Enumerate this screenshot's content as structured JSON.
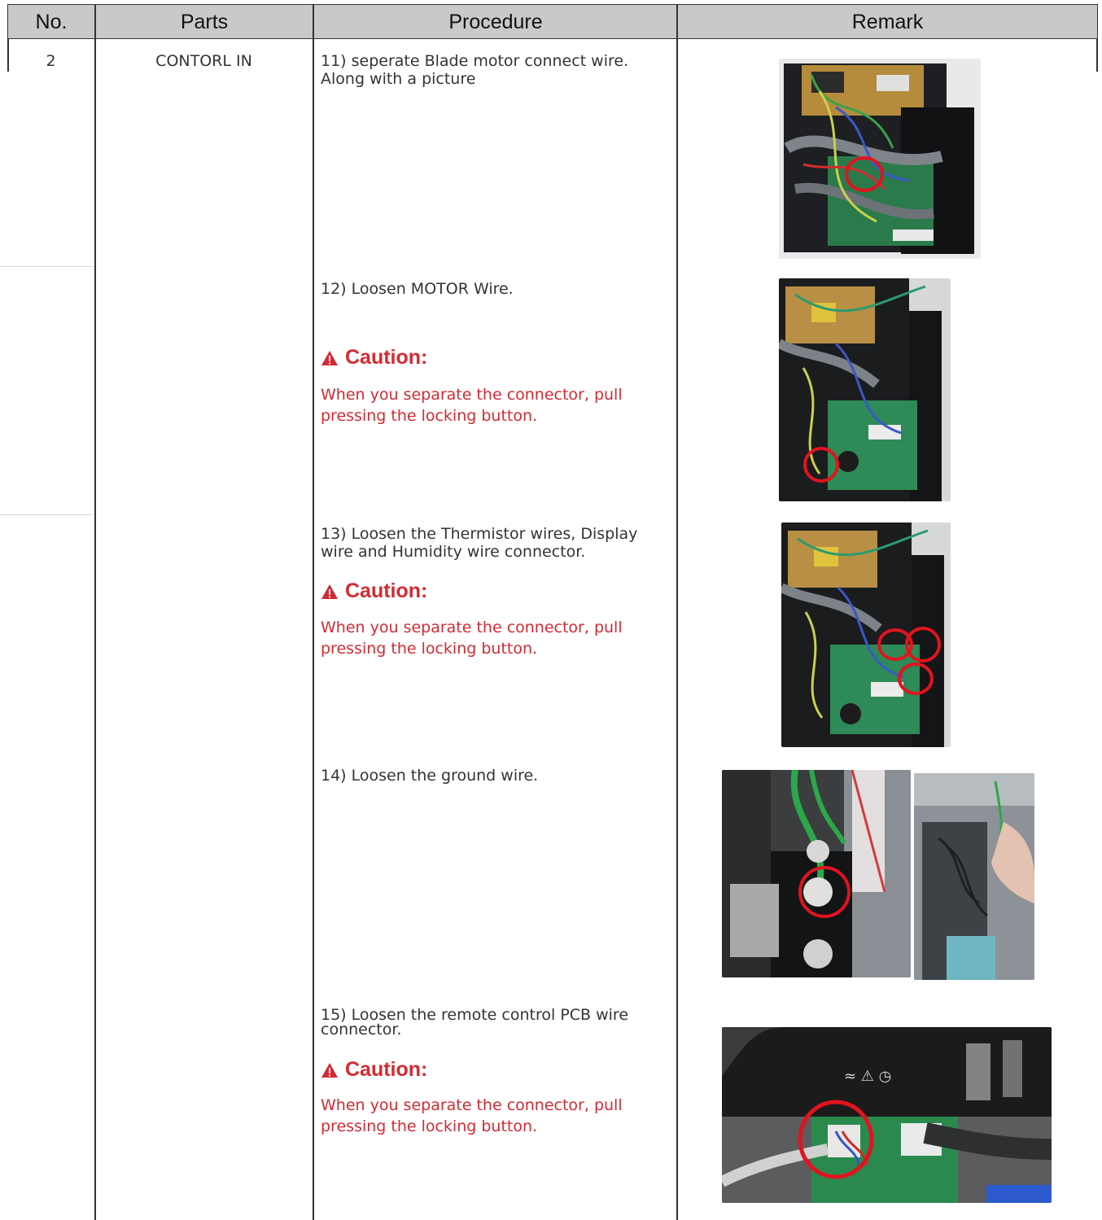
{
  "header": {
    "no": "No.",
    "parts": "Parts",
    "procedure": "Procedure",
    "remark": "Remark"
  },
  "row": {
    "no": "2",
    "parts": "CONTORL IN"
  },
  "steps": [
    {
      "text_line1": "11) seperate Blade motor connect wire.",
      "text_line2": "Along with a picture"
    },
    {
      "text": "12) Loosen MOTOR Wire.",
      "caution_title": "Caution:",
      "caution_body": "When you separate the connector, pull pressing the locking button."
    },
    {
      "text_line1": "13) Loosen the Thermistor wires, Display",
      "text_line2": "wire and Humidity wire connector.",
      "caution_title": "Caution:",
      "caution_body": "When you separate the connector, pull pressing the locking button."
    },
    {
      "text": "14) Loosen the ground wire."
    },
    {
      "text_line1": "15) Loosen the remote control PCB wire",
      "text_line2": "connector.",
      "caution_title": "Caution:",
      "caution_body": "When you separate the connector, pull pressing the locking button."
    }
  ],
  "colors": {
    "header_bg": "#c9c9c9",
    "caution_red": "#d42a32",
    "highlight_circle": "#e0141e"
  },
  "icons": [
    "warning-triangle-icon"
  ]
}
